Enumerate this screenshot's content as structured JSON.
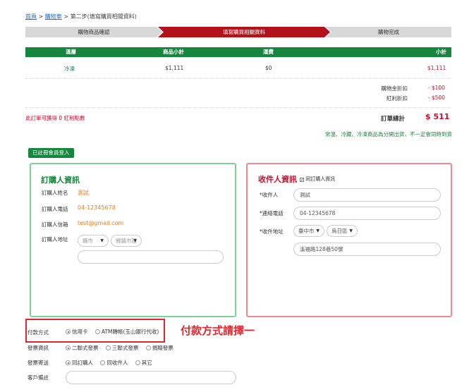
{
  "breadcrumb": {
    "home": "首頁",
    "sep1": ">",
    "cart": "購物車",
    "sep2": ">",
    "current": "第二步(填寫購買相關資料)"
  },
  "steps": [
    "購物商品確認",
    "填寫購買相關資料",
    "購物完成"
  ],
  "table": {
    "headers": [
      "溫層",
      "商品小計",
      "運費",
      "小計"
    ],
    "row": {
      "temp": "冷凍",
      "subtotal": "$1,111",
      "shipping": "$0",
      "total": "$1,111"
    }
  },
  "discounts": [
    {
      "label": "購物金折扣",
      "value": "- $100"
    },
    {
      "label": "紅利折扣",
      "value": "- $500"
    }
  ],
  "bonus_text": "此訂單可獲得 0 紅利點數",
  "order_total": {
    "label": "訂單總計",
    "value": "$ 511"
  },
  "ship_note": "常溫、冷藏、冷凍商品為分開出貨，不一定會同時到貨",
  "member_button": "已註冊會員登入",
  "buyer": {
    "title": "訂購人資訊",
    "name_label": "訂購人姓名",
    "name": "測試",
    "phone_label": "訂購人電話",
    "phone": "04-12345678",
    "email_label": "訂購人信箱",
    "email": "test@gmail.com",
    "address_label": "訂購人地址",
    "city_placeholder": "縣市",
    "district_placeholder": "鄉鎮市區"
  },
  "receiver": {
    "title": "收件人資訊",
    "same_as_buyer": "同訂購人資訊",
    "name_label": "*收件人",
    "name": "測試",
    "phone_label": "*連絡電話",
    "phone": "04-12345678",
    "address_label": "*收件地址",
    "city": "臺中市",
    "district": "烏日區",
    "street": "溪福路128巷50號"
  },
  "payment": {
    "label": "付款方式",
    "options": [
      "信用卡",
      "ATM轉帳(玉山銀行代收)"
    ],
    "hint": "付款方式請擇一"
  },
  "invoice": {
    "label": "發票資訊",
    "options": [
      "二聯式發票",
      "三聯式發票",
      "捐贈發票"
    ]
  },
  "invoice_send": {
    "label": "發票寄送",
    "options": [
      "同訂購人",
      "同收件人",
      "其它"
    ]
  },
  "customer_note": {
    "label": "客戶備註"
  }
}
